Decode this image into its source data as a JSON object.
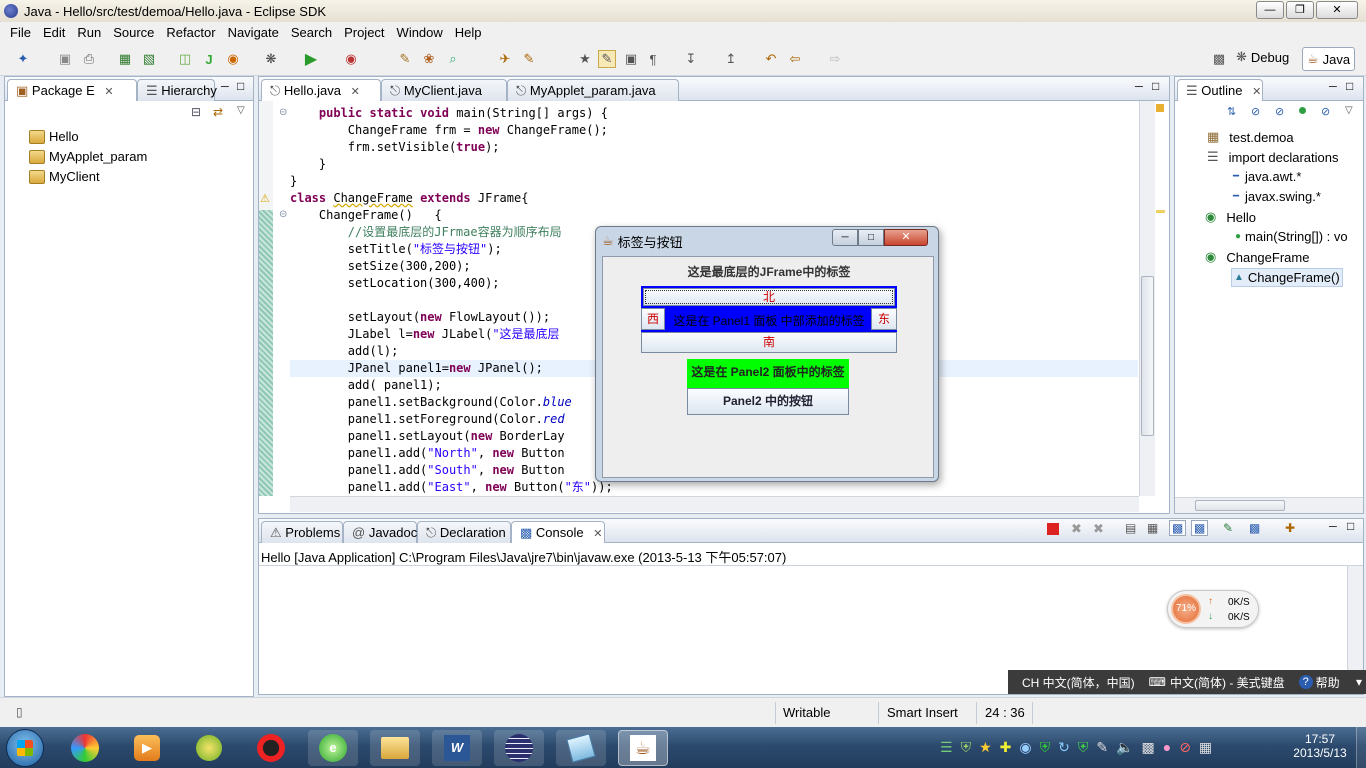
{
  "window": {
    "title": "Java - Hello/src/test/demoa/Hello.java - Eclipse SDK"
  },
  "menu": [
    "File",
    "Edit",
    "Run",
    "Source",
    "Refactor",
    "Navigate",
    "Search",
    "Project",
    "Window",
    "Help"
  ],
  "perspectives": {
    "debug": "Debug",
    "java": "Java"
  },
  "left_panel": {
    "tabs": [
      "Package E",
      "Hierarchy"
    ],
    "items": [
      "Hello",
      "MyApplet_param",
      "MyClient"
    ]
  },
  "editor": {
    "tabs": [
      "Hello.java",
      "MyClient.java",
      "MyApplet_param.java"
    ],
    "lines": [
      "    public static void main(String[] args) {",
      "        ChangeFrame frm = new ChangeFrame();",
      "        frm.setVisible(true);",
      "    }",
      "}",
      "class ChangeFrame extends JFrame{",
      "    ChangeFrame()   {",
      "        //设置最底层的JFrmae容器为顺序布局",
      "        setTitle(\"标签与按钮\");",
      "        setSize(300,200);",
      "        setLocation(300,400);",
      "",
      "        setLayout(new FlowLayout());",
      "        JLabel l=new JLabel(\"这是最底层",
      "        add(l);",
      "        JPanel panel1=new JPanel();",
      "        add( panel1);",
      "        panel1.setBackground(Color.blue",
      "        panel1.setForeground(Color.red",
      "        panel1.setLayout(new BorderLay",
      "        panel1.add(\"North\", new Button",
      "        panel1.add(\"South\", new Button",
      "        panel1.add(\"East\", new Button(\"东\"));"
    ]
  },
  "outline": {
    "title": "Outline",
    "items": [
      "test.demoa",
      "import declarations",
      "java.awt.*",
      "javax.swing.*",
      "Hello",
      "main(String[]) : vo",
      "ChangeFrame",
      "ChangeFrame()"
    ]
  },
  "dialog": {
    "title": "标签与按钮",
    "top_label": "这是最底层的JFrame中的标签",
    "north": "北",
    "west": "西",
    "center": "这是在 Panel1 面板 中部添加的标签",
    "east": "东",
    "south": "南",
    "panel2_label": "这是在 Panel2 面板中的标签",
    "panel2_button": "Panel2 中的按钮",
    "colors": {
      "panel1_bg": "#0000ff",
      "panel2_bg": "#00ff00",
      "label_red": "#cc0000"
    }
  },
  "bottom_tabs": [
    "Problems",
    "Javadoc",
    "Declaration",
    "Console"
  ],
  "console": {
    "header": "Hello [Java Application] C:\\Program Files\\Java\\jre7\\bin\\javaw.exe (2013-5-13 下午05:57:07)"
  },
  "status": {
    "writable": "Writable",
    "insert": "Smart Insert",
    "position": "24 : 36"
  },
  "ime": {
    "lang": "CH 中文(简体，中国)",
    "layout": "中文(简体) - 美式键盘",
    "help": "帮助"
  },
  "net_widget": {
    "percent": "71%",
    "up": "0K/S",
    "down": "0K/S"
  },
  "clock": {
    "time": "17:57",
    "date": "2013/5/13"
  }
}
